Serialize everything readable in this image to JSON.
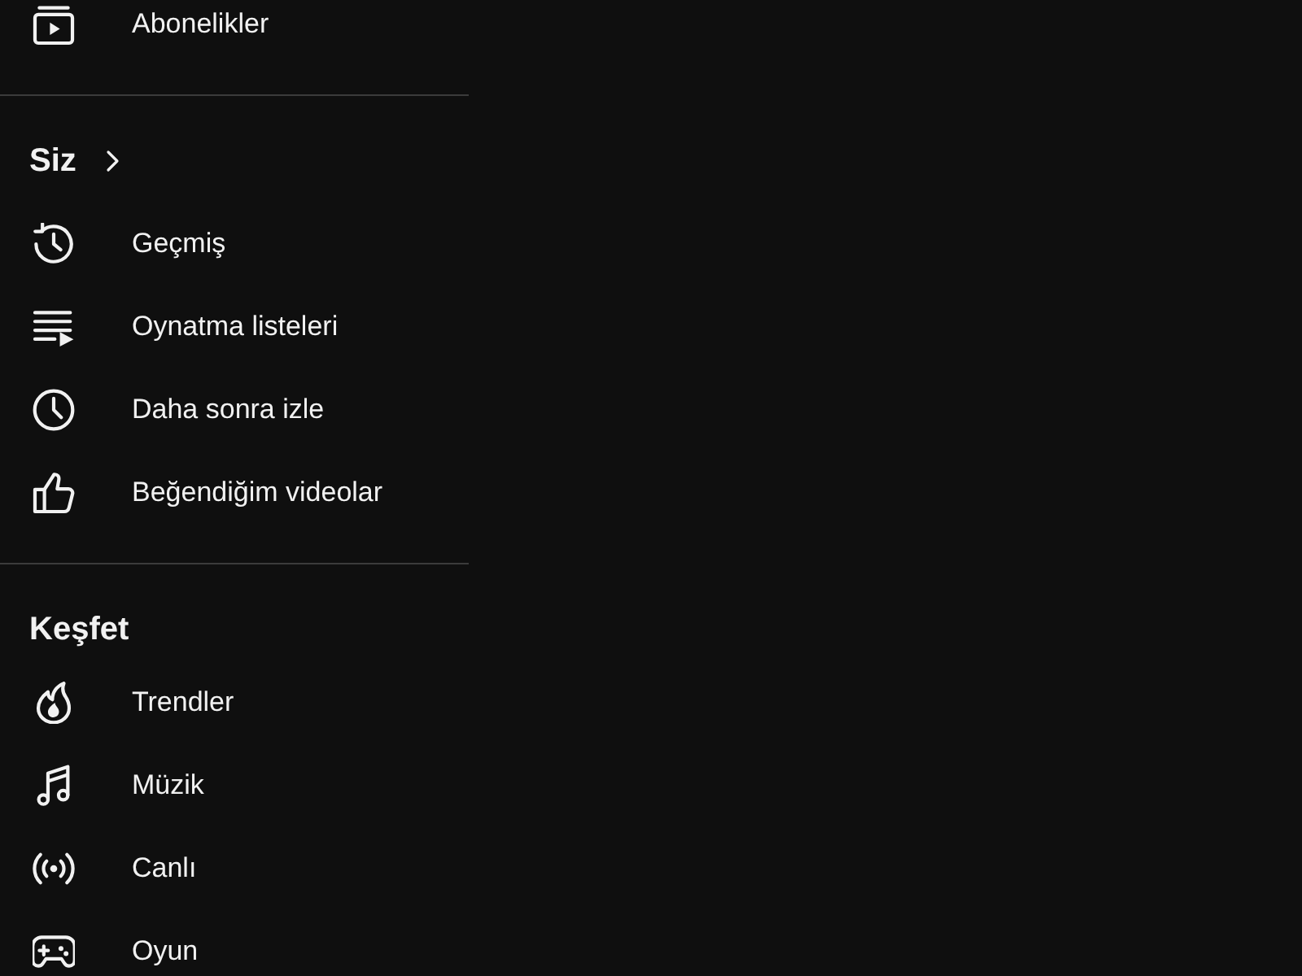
{
  "sidebar": {
    "sections": [
      {
        "items": [
          {
            "label": "Abonelikler",
            "kind": "subscriptions"
          }
        ]
      },
      {
        "header": {
          "label": "Siz",
          "kind": "link"
        },
        "items": [
          {
            "label": "Geçmiş",
            "kind": "history"
          },
          {
            "label": "Oynatma listeleri",
            "kind": "playlists"
          },
          {
            "label": "Daha sonra izle",
            "kind": "watch_later"
          },
          {
            "label": "Beğendiğim videolar",
            "kind": "liked"
          }
        ]
      },
      {
        "header": {
          "label": "Keşfet",
          "kind": "title"
        },
        "items": [
          {
            "label": "Trendler",
            "kind": "trending"
          },
          {
            "label": "Müzik",
            "kind": "music"
          },
          {
            "label": "Canlı",
            "kind": "live"
          },
          {
            "label": "Oyun",
            "kind": "gaming"
          }
        ]
      }
    ]
  }
}
